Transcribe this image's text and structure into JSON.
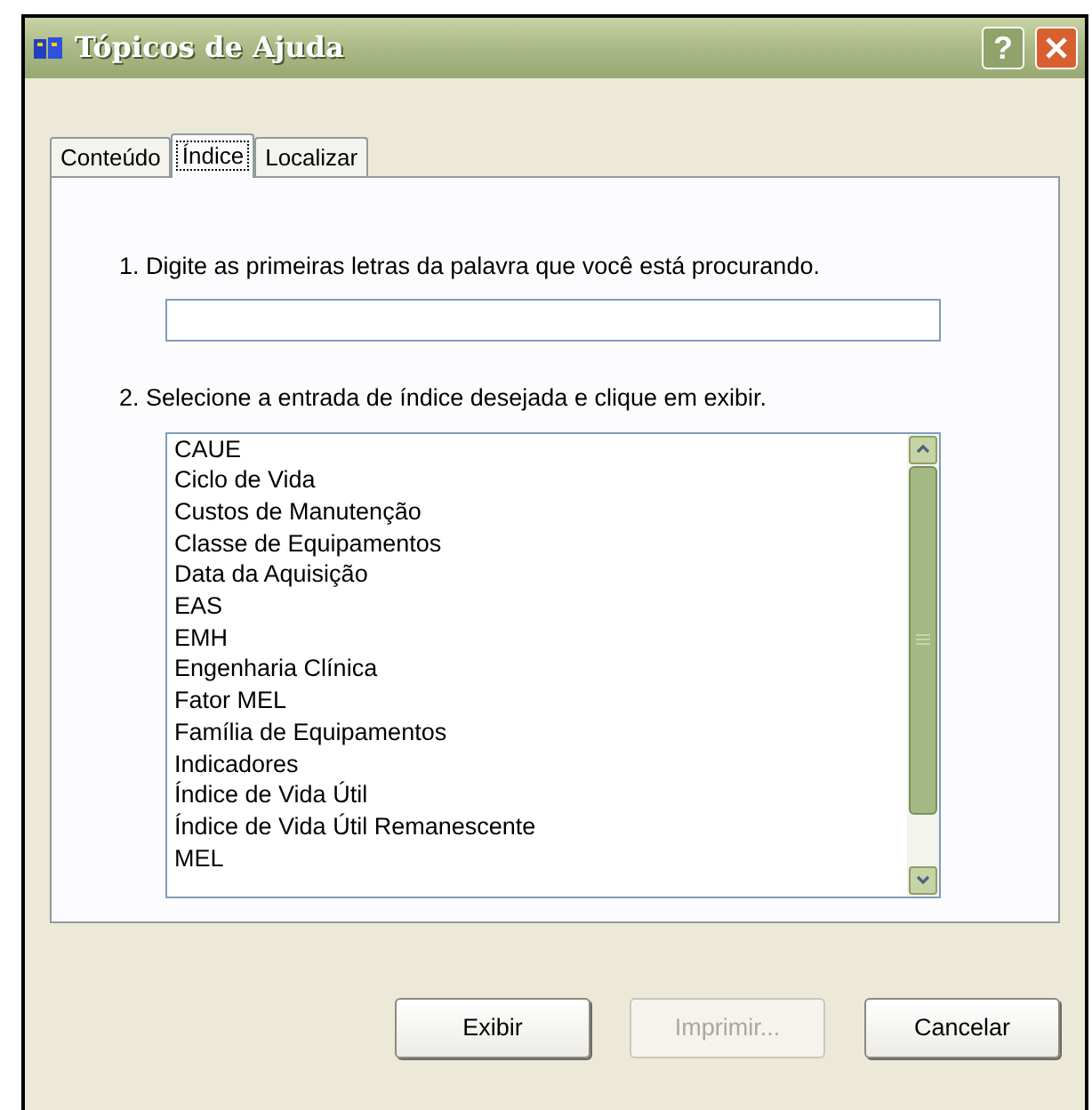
{
  "window": {
    "title": "Tópicos de Ajuda",
    "help_button": "?"
  },
  "tabs": [
    {
      "label": "Conteúdo",
      "selected": false
    },
    {
      "label": "Índice",
      "selected": true
    },
    {
      "label": "Localizar",
      "selected": false
    }
  ],
  "step1": "1. Digite as primeiras letras da palavra que você está procurando.",
  "step2": "2. Selecione a entrada de índice desejada e clique em exibir.",
  "entries": [
    "CAUE",
    "Ciclo de Vida",
    "Custos de Manutenção",
    "Classe de Equipamentos",
    "Data da Aquisição",
    "EAS",
    "EMH",
    "Engenharia Clínica",
    "Fator MEL",
    "Família de Equipamentos",
    "Indicadores",
    "Índice de Vida Útil",
    "Índice de Vida Útil Remanescente",
    "MEL"
  ],
  "buttons": [
    {
      "label": "Exibir",
      "disabled": false
    },
    {
      "label": "Imprimir...",
      "disabled": true
    },
    {
      "label": "Cancelar",
      "disabled": false
    }
  ]
}
